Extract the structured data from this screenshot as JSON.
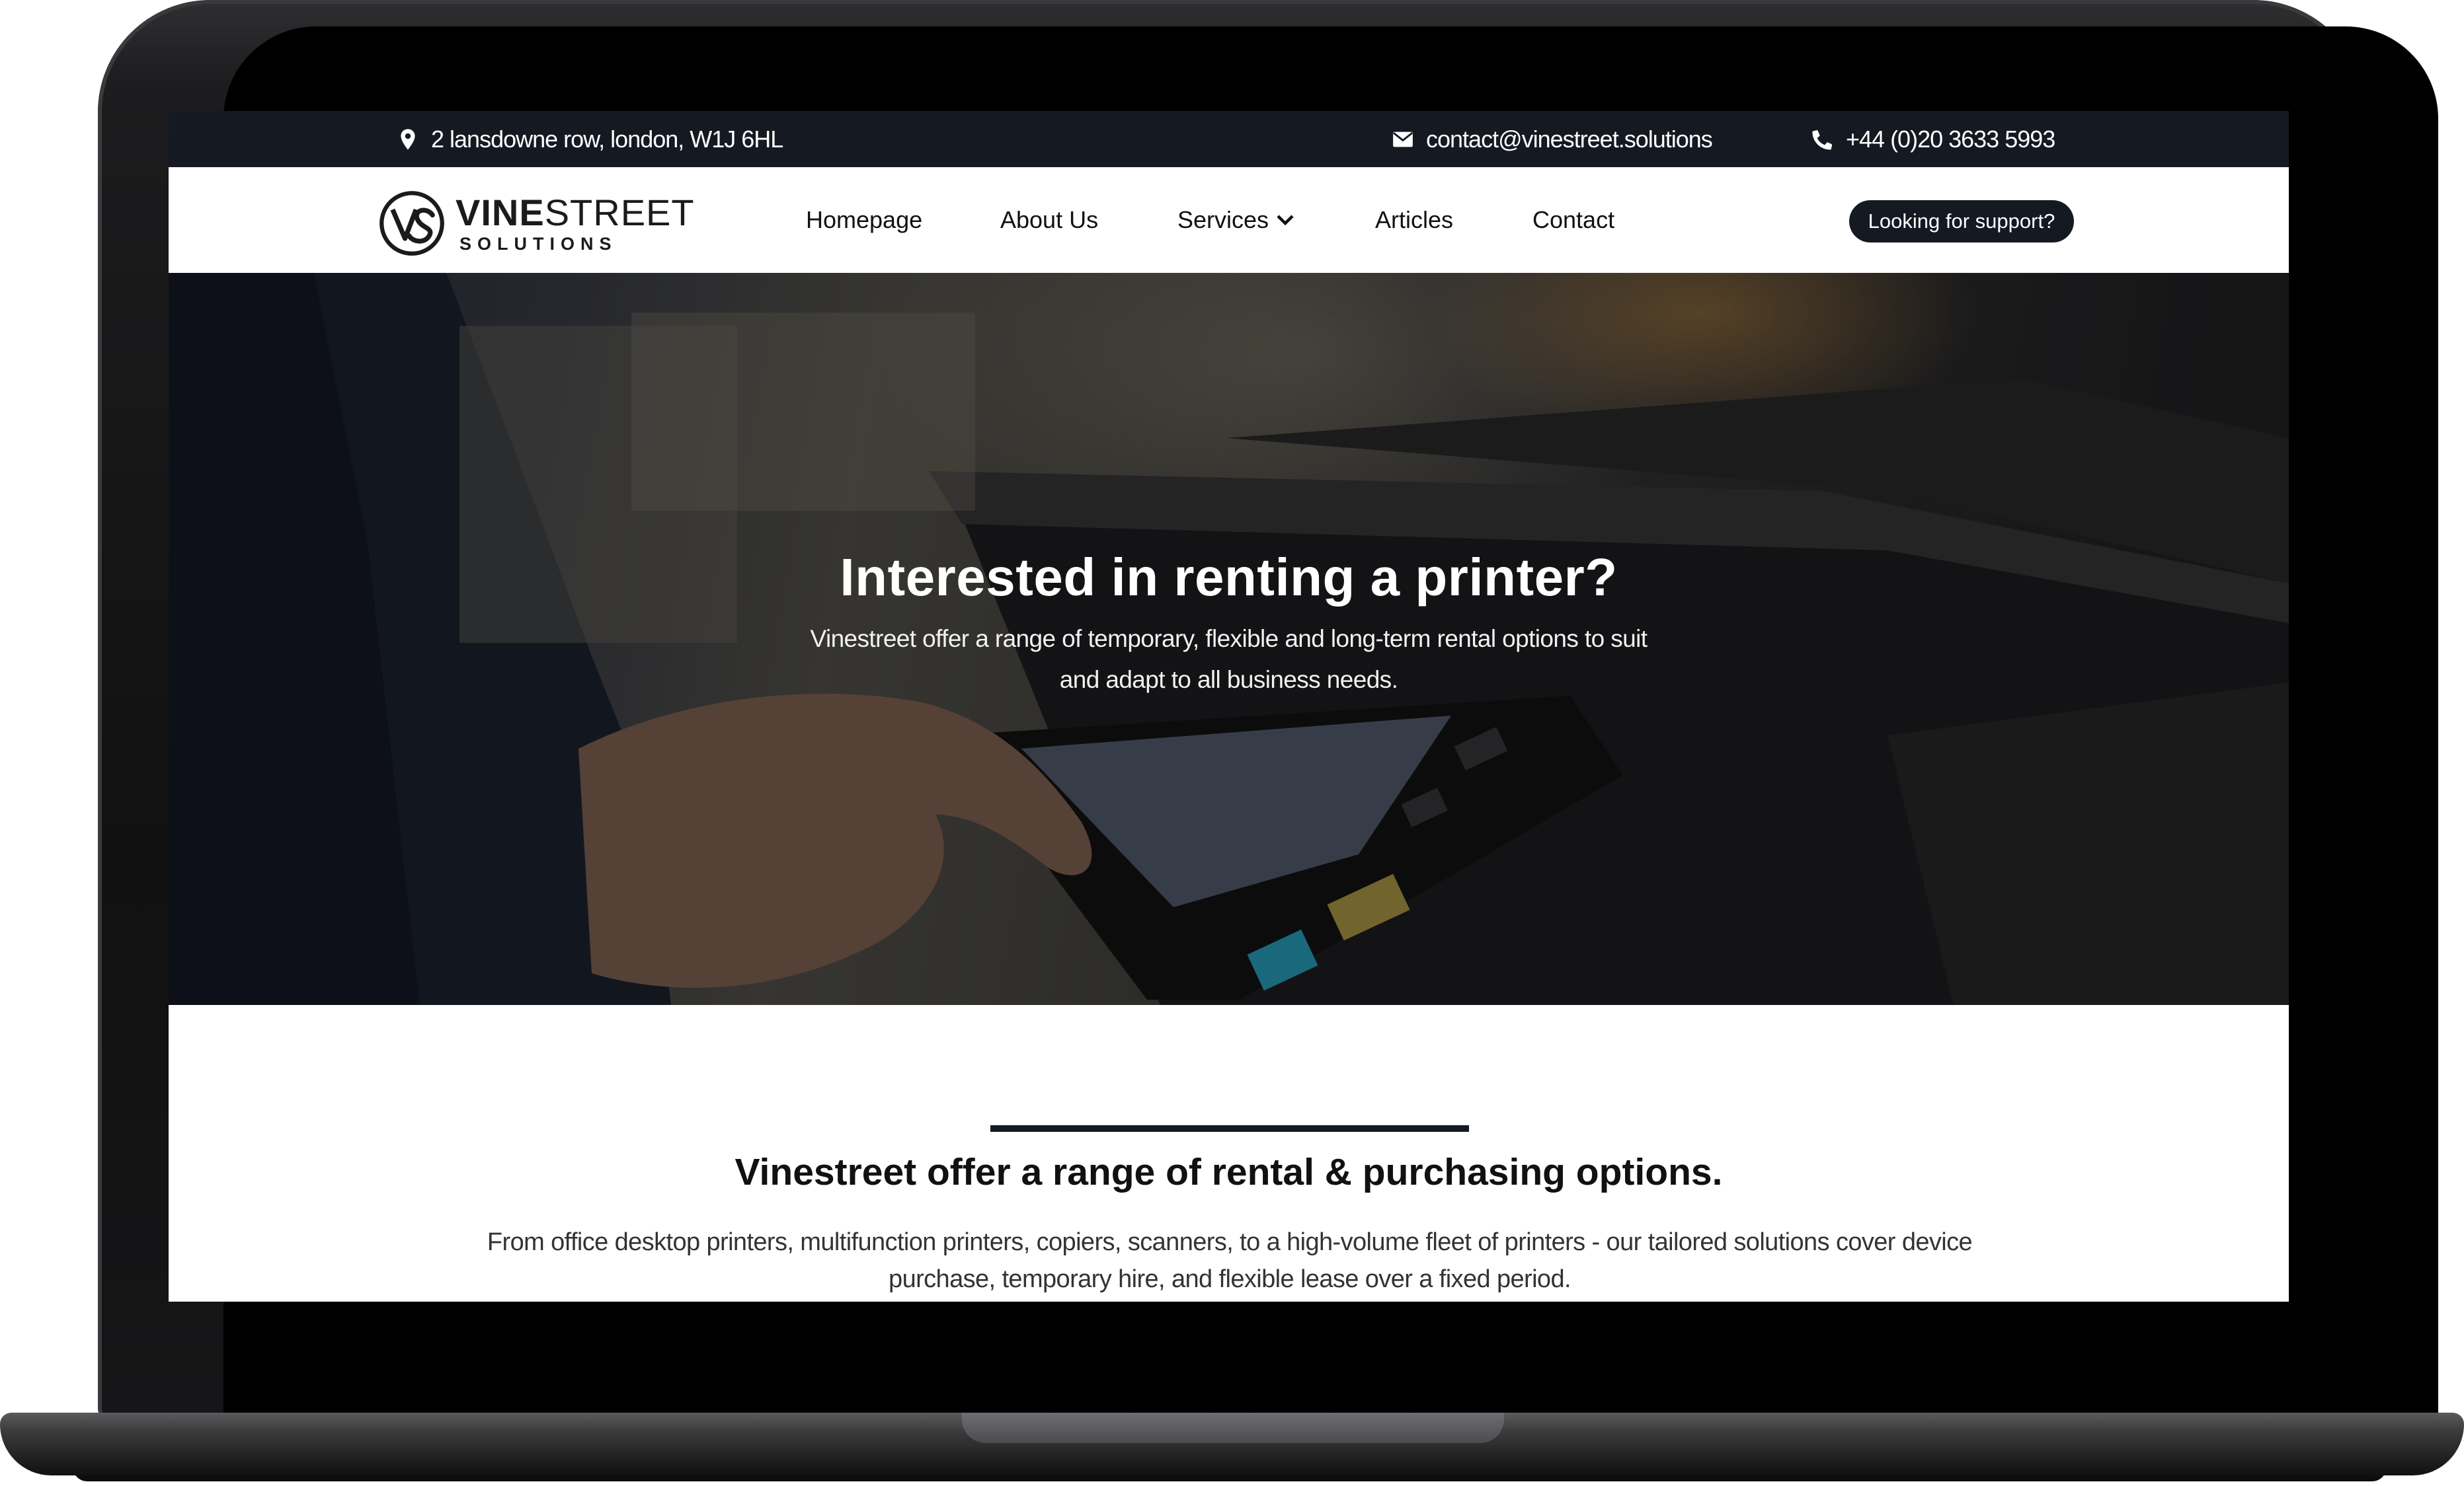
{
  "topbar": {
    "address": "2 lansdowne row, london, W1J 6HL",
    "email": "contact@vinestreet.solutions",
    "phone": "+44 (0)20 3633 5993"
  },
  "logo": {
    "word_bold": "VINE",
    "word_light": "STREET",
    "sub": "SOLUTIONS"
  },
  "nav": {
    "items": [
      {
        "label": "Homepage"
      },
      {
        "label": "About Us"
      },
      {
        "label": "Services"
      },
      {
        "label": "Articles"
      },
      {
        "label": "Contact"
      }
    ],
    "support_label": "Looking for support?"
  },
  "hero": {
    "title": "Interested in renting a printer?",
    "subtitle": "Vinestreet offer a range of temporary, flexible and long-term rental options to suit and adapt to all business needs."
  },
  "section": {
    "title": "Vinestreet offer a range of rental & purchasing options.",
    "text": "From office desktop printers, multifunction printers, copiers, scanners, to a high-volume fleet of printers - our tailored solutions cover device purchase, temporary hire, and flexible lease over a fixed period."
  },
  "colors": {
    "topbar_bg": "#151922",
    "button_bg": "#151922",
    "accent_divider": "#151922"
  },
  "icons": {
    "address": "map-pin-icon",
    "email": "envelope-icon",
    "phone": "phone-icon",
    "services_dropdown": "chevron-down-icon"
  }
}
